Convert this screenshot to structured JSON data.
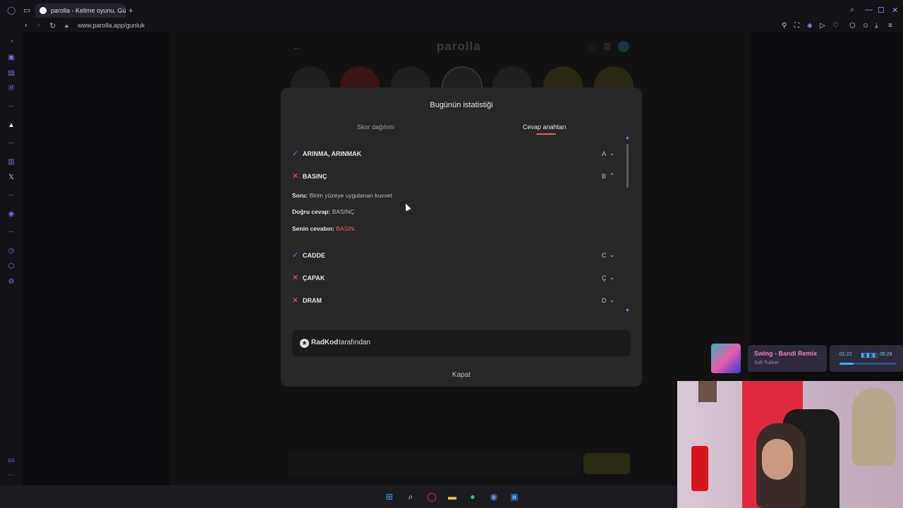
{
  "browser": {
    "tab_title": "parolla - Kelime oyunu. Gü",
    "new_tab": "+",
    "url": "www.parolla.app/gunluk"
  },
  "app": {
    "logo_text": "parolla"
  },
  "modal": {
    "title": "Bugünün istatistiği",
    "tabs": [
      {
        "label": "Skor dağılımı",
        "active": false
      },
      {
        "label": "Cevap anahtarı",
        "active": true
      }
    ],
    "answers": [
      {
        "word": "ARINMA, ARINMAK",
        "letter": "A",
        "correct": true,
        "expanded": false
      },
      {
        "word": "BASINÇ",
        "letter": "B",
        "correct": false,
        "expanded": true
      },
      {
        "word": "CADDE",
        "letter": "C",
        "correct": true,
        "expanded": false
      },
      {
        "word": "ÇAPAK",
        "letter": "Ç",
        "correct": false,
        "expanded": false
      },
      {
        "word": "DRAM",
        "letter": "D",
        "correct": false,
        "expanded": false
      }
    ],
    "detail": {
      "question_label": "Soru:",
      "question_value": "Birim yüzeye uygulanan kuvvet",
      "correct_label": "Doğru cevap:",
      "correct_value": "BASINÇ",
      "yours_label": "Senin cevabın:",
      "yours_value": "BASIN."
    },
    "credit_name": "RadKod",
    "credit_suffix": "tarafından",
    "close_label": "Kapat"
  },
  "music": {
    "title": "Swing - Bandi Remix",
    "artist": "Sofi Tukker",
    "elapsed": "01:22",
    "total": "05:29",
    "progress": 0.25
  },
  "sidebar": {
    "bottom_label": "GX"
  },
  "colors": {
    "accent_check": "#7c6bff",
    "wrong_cross": "#ff4a6e",
    "tab_underline": "#e5645f"
  }
}
